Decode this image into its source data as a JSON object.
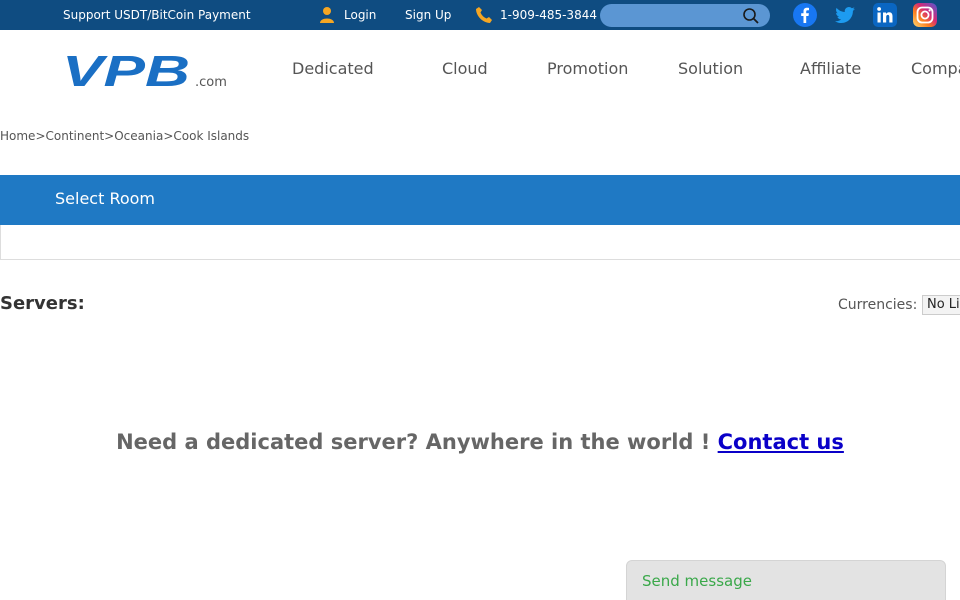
{
  "topbar": {
    "payment_text": "Support USDT/BitCoin Payment",
    "login_label": "Login",
    "signup_label": "Sign Up",
    "phone": "1-909-485-3844",
    "search_placeholder": "",
    "social_icons": [
      "facebook-icon",
      "twitter-icon",
      "linkedin-icon",
      "instagram-icon"
    ],
    "bg_color": "#0f4c81"
  },
  "header": {
    "logo_text": "VPB",
    "logo_suffix": ".com",
    "nav": [
      "Dedicated",
      "Cloud",
      "Promotion",
      "Solution",
      "Affiliate",
      "Company"
    ]
  },
  "breadcrumb": {
    "items": [
      "Home",
      "Continent",
      "Oceania",
      "Cook Islands"
    ],
    "separator": ">"
  },
  "room": {
    "label": "Select Room",
    "bar_color": "#1f79c4"
  },
  "servers": {
    "title": "Servers:",
    "currencies_label": "Currencies:",
    "currency_value": "No Limit"
  },
  "cta": {
    "text": "Need a dedicated server? Anywhere in the world ! ",
    "link": "Contact us"
  },
  "chat": {
    "label": "Send message"
  }
}
